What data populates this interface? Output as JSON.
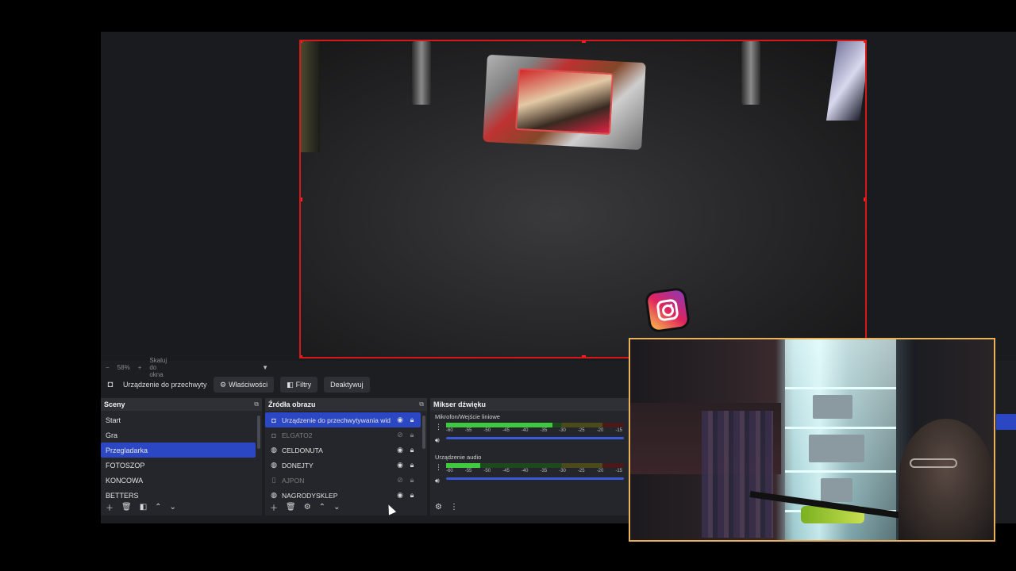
{
  "zoom_bar": {
    "minus": "−",
    "percent": "58%",
    "plus": "+",
    "mode": "Skaluj do okna"
  },
  "source_toolbar": {
    "selected_source": "Urządzenie do przechwyty",
    "properties_label": "Właściwości",
    "filters_label": "Filtry",
    "deactivate_label": "Deaktywuj"
  },
  "scenes": {
    "title": "Sceny",
    "items": [
      {
        "label": "Start"
      },
      {
        "label": "Gra"
      },
      {
        "label": "Przegladarka"
      },
      {
        "label": "FOTOSZOP"
      },
      {
        "label": "KONCOWA"
      },
      {
        "label": "BETTERS"
      }
    ],
    "active_index": 2
  },
  "sources": {
    "title": "Źródła obrazu",
    "items": [
      {
        "label": "Urządzenie do przechwytywania wid",
        "icon": "camera-icon",
        "visible": true
      },
      {
        "label": "ELGATO2",
        "icon": "camera-icon",
        "visible": false
      },
      {
        "label": "CELDONUTA",
        "icon": "browser-icon",
        "visible": true
      },
      {
        "label": "DONEJTY",
        "icon": "browser-icon",
        "visible": true
      },
      {
        "label": "AJPON",
        "icon": "file-icon",
        "visible": false
      },
      {
        "label": "NAGRODYSKLEP",
        "icon": "browser-icon",
        "visible": true
      }
    ]
  },
  "mixer": {
    "title": "Mikser dźwięku",
    "channels": [
      {
        "name": "Mikrofon/Wejście liniowe",
        "level": 0.6
      },
      {
        "name": "Urządzenie audio",
        "level": 0.19
      }
    ],
    "ticks": [
      "-60",
      "-55",
      "-50",
      "-45",
      "-40",
      "-35",
      "-30",
      "-25",
      "-20",
      "-15"
    ]
  },
  "colors": {
    "accent": "#2b47c4",
    "selection_border": "#d81818",
    "webcam_border": "#e9b25a"
  }
}
